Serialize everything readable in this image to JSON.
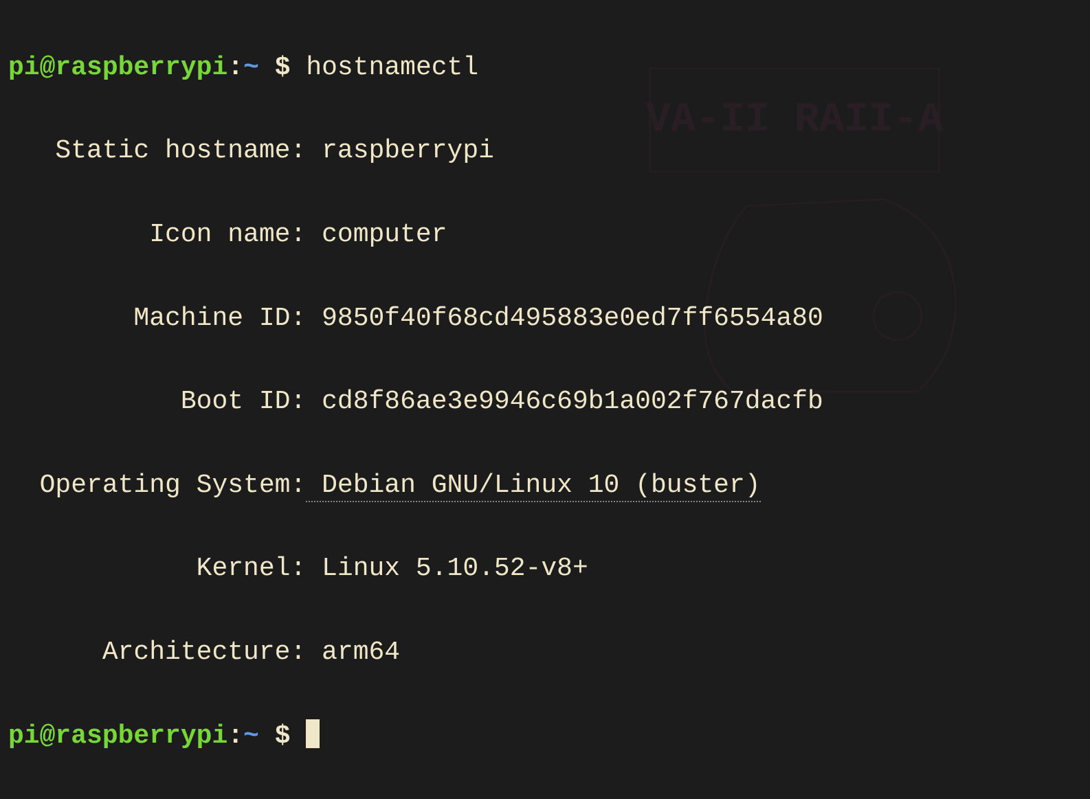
{
  "prompt": {
    "user_host": "pi@raspberrypi",
    "colon": ":",
    "path": "~",
    "dollar": " $ "
  },
  "command": "hostnamectl",
  "output": {
    "rows": [
      {
        "label": "   Static hostname:",
        "value": " raspberrypi",
        "underline": false
      },
      {
        "label": "         Icon name:",
        "value": " computer",
        "underline": false
      },
      {
        "label": "        Machine ID:",
        "value": " 9850f40f68cd495883e0ed7ff6554a80",
        "underline": false
      },
      {
        "label": "           Boot ID:",
        "value": " cd8f86ae3e9946c69b1a002f767dacfb",
        "underline": false
      },
      {
        "label": "  Operating System:",
        "value": " Debian GNU/Linux 10 (buster)",
        "underline": true
      },
      {
        "label": "            Kernel:",
        "value": " Linux 5.10.52-v8+",
        "underline": false
      },
      {
        "label": "      Architecture:",
        "value": " arm64",
        "underline": false
      }
    ]
  }
}
